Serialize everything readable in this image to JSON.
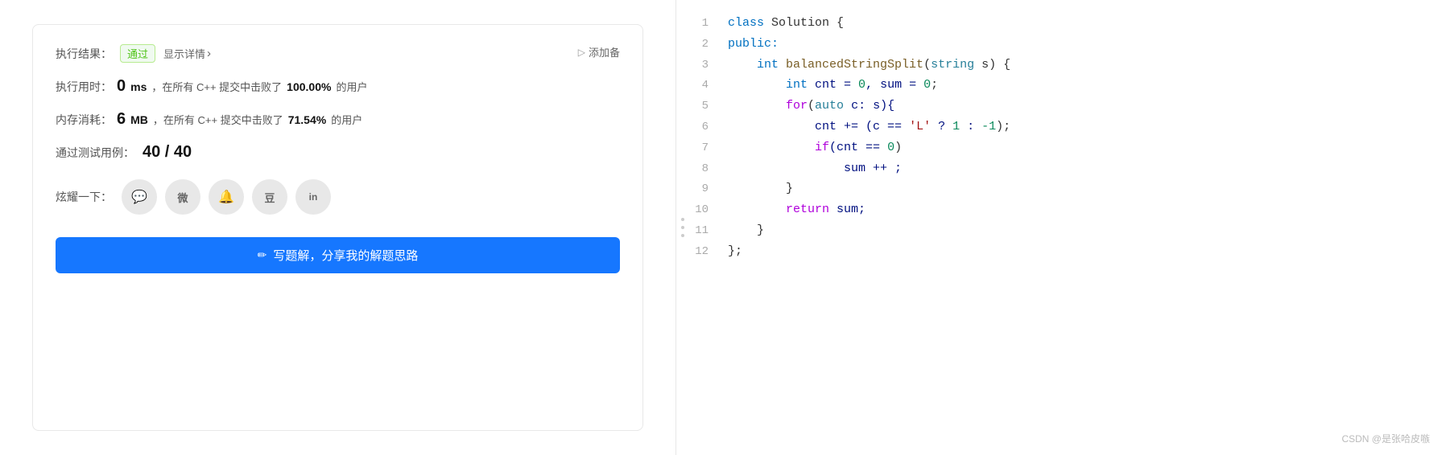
{
  "left": {
    "result_label": "执行结果：",
    "pass_badge": "通过",
    "show_detail": "显示详情",
    "add_note": "添加备",
    "time_label": "执行用时：",
    "time_value": "0",
    "time_unit": "ms",
    "time_desc": "，在所有 C++ 提交中击败了",
    "time_percent": "100.00%",
    "time_suffix": "的用户",
    "mem_label": "内存消耗：",
    "mem_value": "6",
    "mem_unit": "MB",
    "mem_desc": "，在所有 C++ 提交中击败了",
    "mem_percent": "71.54%",
    "mem_suffix": "的用户",
    "test_label": "通过测试用例：",
    "test_value": "40 / 40",
    "share_label": "炫耀一下：",
    "write_btn": "写题解，分享我的解题思路"
  },
  "social": [
    {
      "name": "wechat",
      "icon": "💬"
    },
    {
      "name": "weibo",
      "icon": "微"
    },
    {
      "name": "bell",
      "icon": "🔔"
    },
    {
      "name": "douban",
      "icon": "豆"
    },
    {
      "name": "linkedin",
      "icon": "in"
    }
  ],
  "code": {
    "lines": [
      {
        "num": 1,
        "tokens": [
          {
            "text": "class ",
            "cls": "kw-blue"
          },
          {
            "text": "Solution ",
            "cls": "plain"
          },
          {
            "text": "{",
            "cls": "plain"
          }
        ]
      },
      {
        "num": 2,
        "tokens": [
          {
            "text": "public:",
            "cls": "kw-blue"
          }
        ]
      },
      {
        "num": 3,
        "tokens": [
          {
            "text": "    ",
            "cls": "plain"
          },
          {
            "text": "int ",
            "cls": "kw-blue"
          },
          {
            "text": "balancedStringSplit",
            "cls": "fn-yellow"
          },
          {
            "text": "(",
            "cls": "plain"
          },
          {
            "text": "string ",
            "cls": "type-green"
          },
          {
            "text": "s) {",
            "cls": "plain"
          }
        ]
      },
      {
        "num": 4,
        "tokens": [
          {
            "text": "        ",
            "cls": "plain"
          },
          {
            "text": "int ",
            "cls": "kw-blue"
          },
          {
            "text": "cnt = ",
            "cls": "default"
          },
          {
            "text": "0",
            "cls": "num-green"
          },
          {
            "text": ", sum = ",
            "cls": "default"
          },
          {
            "text": "0",
            "cls": "num-green"
          },
          {
            "text": ";",
            "cls": "plain"
          }
        ]
      },
      {
        "num": 5,
        "tokens": [
          {
            "text": "        ",
            "cls": "plain"
          },
          {
            "text": "for",
            "cls": "kw-purple"
          },
          {
            "text": "(",
            "cls": "plain"
          },
          {
            "text": "auto ",
            "cls": "type-green"
          },
          {
            "text": "c: s){",
            "cls": "default"
          }
        ]
      },
      {
        "num": 6,
        "tokens": [
          {
            "text": "            ",
            "cls": "plain"
          },
          {
            "text": "cnt += (c == ",
            "cls": "default"
          },
          {
            "text": "'L'",
            "cls": "str-red"
          },
          {
            "text": " ? ",
            "cls": "default"
          },
          {
            "text": "1",
            "cls": "num-green"
          },
          {
            "text": " : ",
            "cls": "default"
          },
          {
            "text": "-1",
            "cls": "num-green"
          },
          {
            "text": ");",
            "cls": "plain"
          }
        ]
      },
      {
        "num": 7,
        "tokens": [
          {
            "text": "            ",
            "cls": "plain"
          },
          {
            "text": "if",
            "cls": "kw-purple"
          },
          {
            "text": "(cnt == ",
            "cls": "default"
          },
          {
            "text": "0",
            "cls": "num-green"
          },
          {
            "text": ")",
            "cls": "plain"
          }
        ]
      },
      {
        "num": 8,
        "tokens": [
          {
            "text": "                ",
            "cls": "plain"
          },
          {
            "text": "sum ++ ;",
            "cls": "default"
          }
        ]
      },
      {
        "num": 9,
        "tokens": [
          {
            "text": "        }",
            "cls": "plain"
          }
        ]
      },
      {
        "num": 10,
        "tokens": [
          {
            "text": "        ",
            "cls": "plain"
          },
          {
            "text": "return ",
            "cls": "kw-purple"
          },
          {
            "text": "sum;",
            "cls": "default"
          }
        ]
      },
      {
        "num": 11,
        "tokens": [
          {
            "text": "    }",
            "cls": "plain"
          }
        ]
      },
      {
        "num": 12,
        "tokens": [
          {
            "text": "};",
            "cls": "plain"
          }
        ]
      }
    ]
  },
  "watermark": "CSDN @是张哈皮嗾"
}
